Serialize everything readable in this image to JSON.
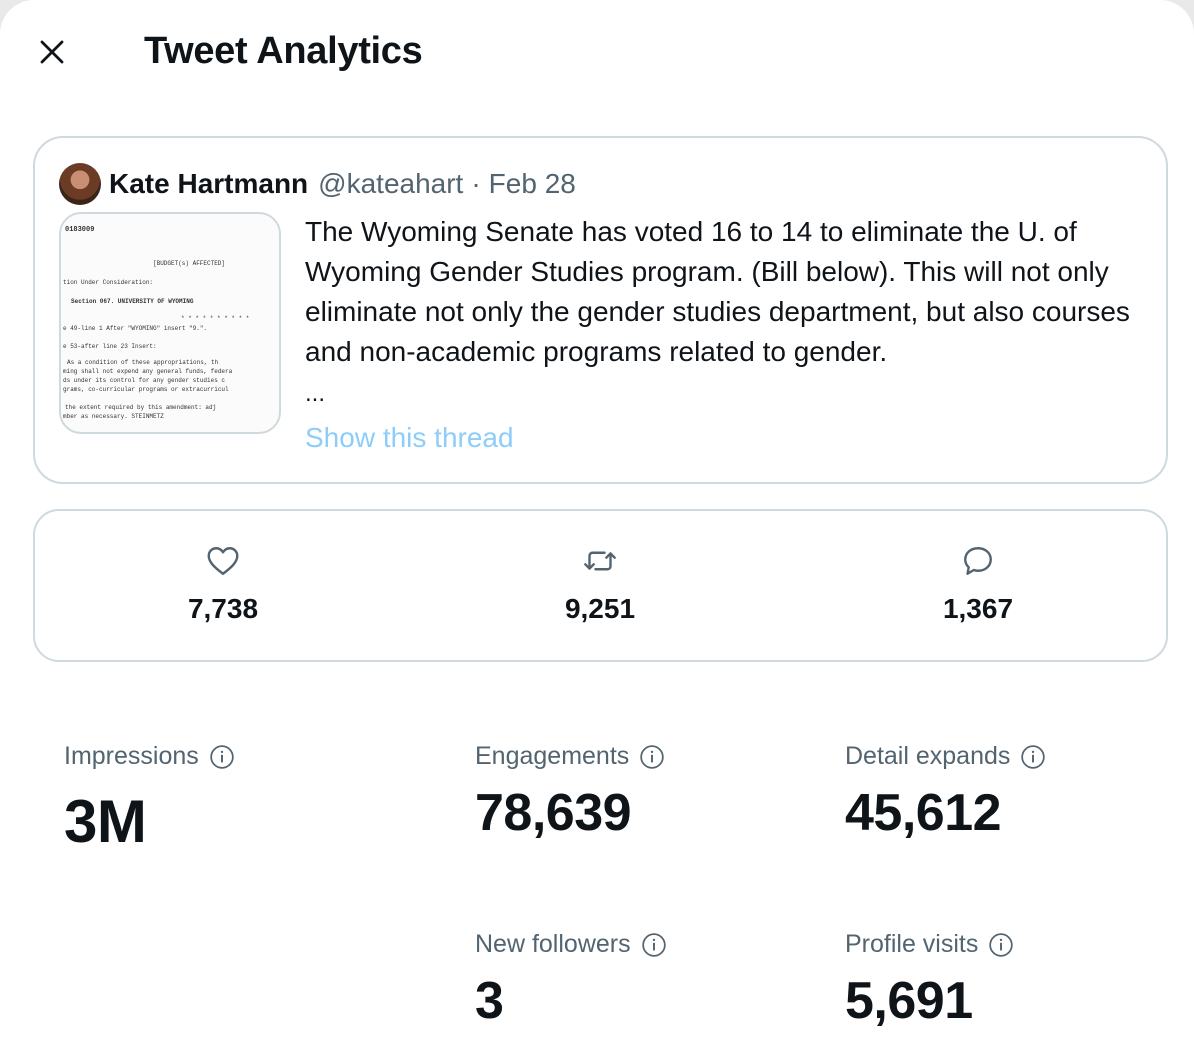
{
  "header": {
    "title": "Tweet Analytics",
    "close_icon": "close-icon"
  },
  "tweet": {
    "author_name": "Kate Hartmann",
    "handle": "@kateahart",
    "separator": "·",
    "date": "Feb 28",
    "text": "The Wyoming Senate has voted 16 to 14 to eliminate the U. of Wyoming Gender Studies program. (Bill below). This will not only eliminate not only the gender studies department, but also courses and non-academic programs related to gender.",
    "ellipsis": "...",
    "show_thread": "Show this thread",
    "attached_image_text": {
      "line1": "0183009",
      "line2": "[BUDGET(s) AFFECTED]",
      "line3": "tion Under Consideration:",
      "line4": "Section 067. UNIVERSITY OF WYOMING",
      "line5": "e 49-line 1      After \"WYOMING\" insert \"9.\".",
      "line6": "e 53-after line 23     Insert:",
      "line7": "As a condition of these appropriations, th",
      "line8": "ming shall not expend any general funds, federa",
      "line9": "ds under its control for any gender studies c",
      "line10": "grams, co-curricular programs or extracurricul",
      "line11": "the extent required by this amendment: adj",
      "line12": "mber as necessary. STEINMETZ"
    }
  },
  "engagement": {
    "likes": {
      "icon": "heart-icon",
      "count": "7,738"
    },
    "retweets": {
      "icon": "retweet-icon",
      "count": "9,251"
    },
    "replies": {
      "icon": "reply-icon",
      "count": "1,367"
    }
  },
  "stats": {
    "impressions": {
      "label": "Impressions",
      "value": "3M"
    },
    "engagements": {
      "label": "Engagements",
      "value": "78,639"
    },
    "detail_expands": {
      "label": "Detail expands",
      "value": "45,612"
    },
    "new_followers": {
      "label": "New followers",
      "value": "3"
    },
    "profile_visits": {
      "label": "Profile visits",
      "value": "5,691"
    }
  },
  "colors": {
    "text_primary": "#0f1419",
    "text_secondary": "#536471",
    "border": "#cfd9de",
    "link_faded": "#8ecdf8"
  }
}
